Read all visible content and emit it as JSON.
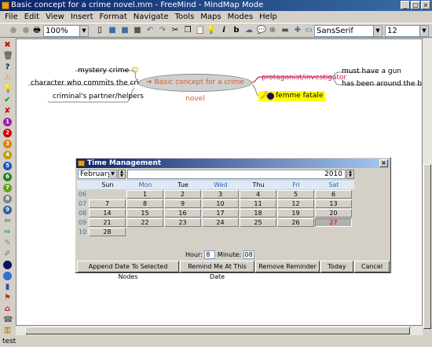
{
  "window": {
    "title": "Basic concept for a crime novel.mm - FreeMind - MindMap Mode",
    "min": "_",
    "max": "□",
    "close": "×"
  },
  "menu": [
    "File",
    "Edit",
    "View",
    "Insert",
    "Format",
    "Navigate",
    "Tools",
    "Maps",
    "Modes",
    "Help"
  ],
  "toolbar": {
    "zoom": "100%",
    "font": "SansSerif",
    "size": "12"
  },
  "map": {
    "root": "➜ Basic concept for a crime novel",
    "left_nodes": [
      "mystery crime",
      "character who commits the crime",
      "criminal's partner/helpers"
    ],
    "right_nodes": [
      "protagonist/investigator",
      "femme fatale"
    ],
    "sub_nodes": [
      "must have a gun",
      "has been around the block a"
    ]
  },
  "dialog": {
    "title": "Time Management",
    "close": "×",
    "month": "February",
    "year": "2010",
    "days": [
      "Sun",
      "Mon",
      "Tue",
      "Wed",
      "Thu",
      "Fri",
      "Sat"
    ],
    "weeks": [
      {
        "num": "06",
        "days": [
          "",
          "1",
          "2",
          "3",
          "4",
          "5",
          "6"
        ]
      },
      {
        "num": "07",
        "days": [
          "7",
          "8",
          "9",
          "10",
          "11",
          "12",
          "13"
        ]
      },
      {
        "num": "08",
        "days": [
          "14",
          "15",
          "16",
          "17",
          "18",
          "19",
          "20"
        ]
      },
      {
        "num": "09",
        "days": [
          "21",
          "22",
          "23",
          "24",
          "25",
          "26",
          "27"
        ]
      },
      {
        "num": "10",
        "days": [
          "28",
          "",
          "",
          "",
          "",
          "",
          ""
        ]
      }
    ],
    "selected": "27",
    "hour_label": "Hour:",
    "hour": "8",
    "minute_label": "Minute:",
    "minute": "08",
    "buttons": [
      "Append Date To Selected Nodes",
      "Remind Me At This Date",
      "Remove Reminder",
      "Today",
      "Cancel"
    ]
  },
  "status": "test"
}
